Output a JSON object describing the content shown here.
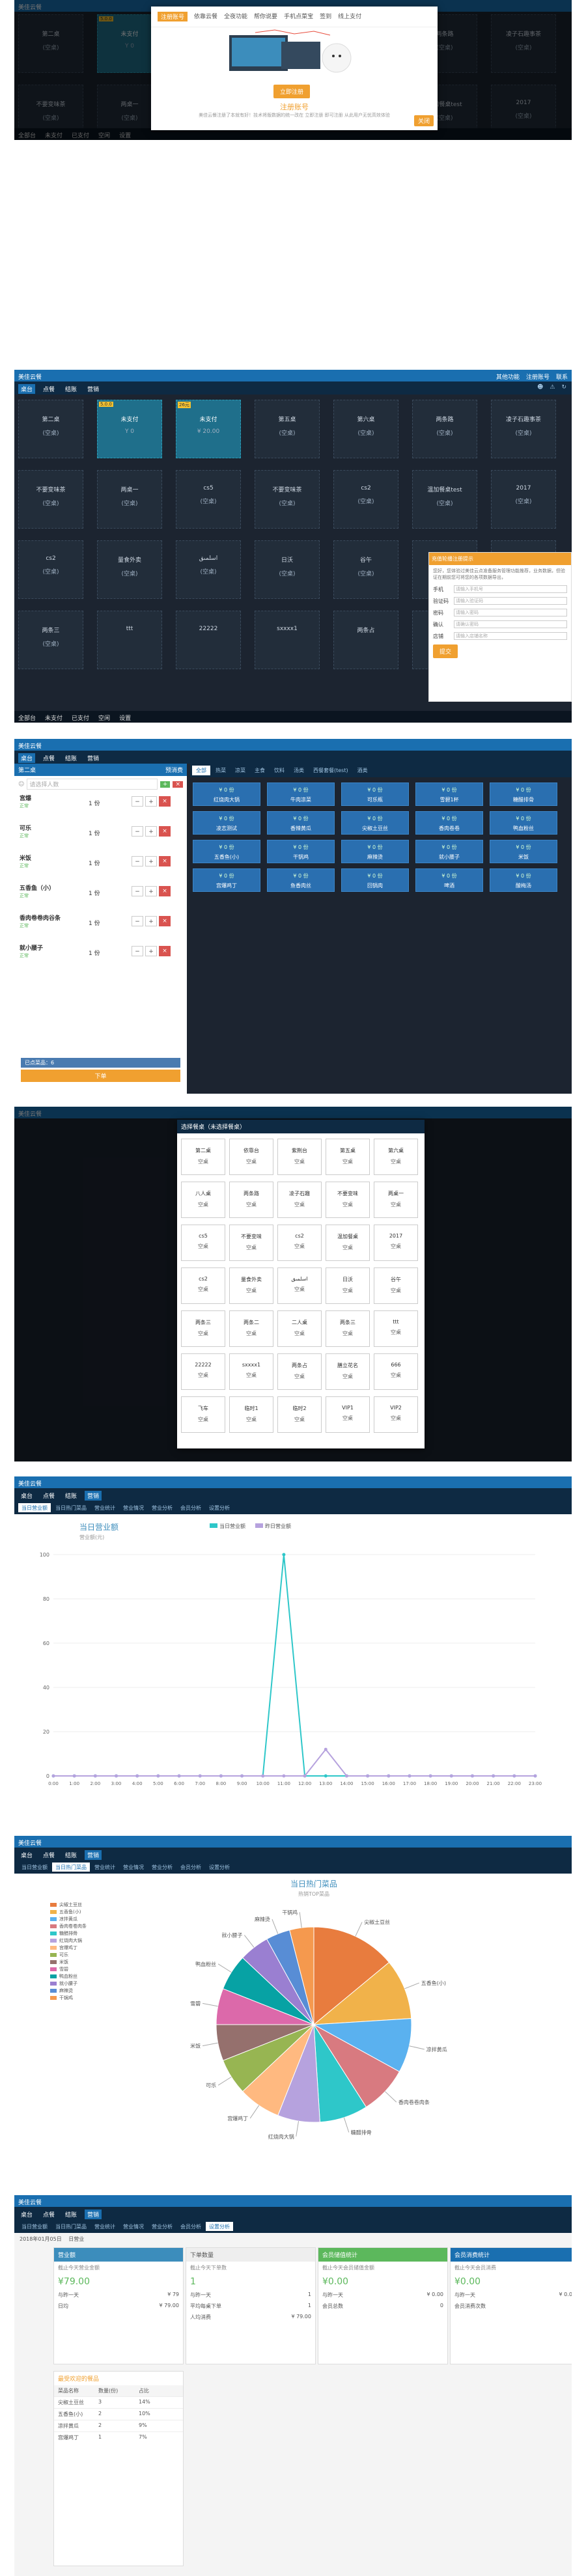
{
  "app": {
    "brand": "美佳云餐",
    "top_right": [
      "其他功能",
      "注册账号",
      "联系"
    ],
    "nav": [
      "桌台",
      "点餐",
      "结账",
      "营销"
    ],
    "bottom": [
      "全部台",
      "未支付",
      "已支付",
      "空闲",
      "设置"
    ]
  },
  "tables": [
    {
      "name": "第二桌",
      "status": "(空桌)"
    },
    {
      "name": "未支付",
      "status": "Y 0",
      "busy": true,
      "flag": "5.0.0"
    },
    {
      "name": "未支付",
      "status": "¥ 20.00",
      "busy": true,
      "flag": "26元"
    },
    {
      "name": "第五桌",
      "status": "(空桌)"
    },
    {
      "name": "第六桌",
      "status": "(空桌)"
    },
    {
      "name": "两条路",
      "status": "(空桌)"
    },
    {
      "name": "凌子石趣事茶",
      "status": "(空桌)"
    },
    {
      "name": "不要变味茶",
      "status": "(空桌)"
    },
    {
      "name": "两桌一",
      "status": "(空桌)"
    },
    {
      "name": "cs5",
      "status": "(空桌)"
    },
    {
      "name": "不要变味茶",
      "status": "(空桌)"
    },
    {
      "name": "cs2",
      "status": "(空桌)"
    },
    {
      "name": "温加餐桌test",
      "status": "(空桌)"
    },
    {
      "name": "2017",
      "status": "(空桌)"
    },
    {
      "name": "cs2",
      "status": "(空桌)"
    },
    {
      "name": "量食外卖",
      "status": "(空桌)"
    },
    {
      "name": "اسلمىق",
      "status": "(空桌)"
    },
    {
      "name": "日沃",
      "status": "(空桌)"
    },
    {
      "name": "谷午",
      "status": "(空桌)"
    },
    {
      "name": "两条三",
      "status": "(空桌)"
    },
    {
      "name": "二人桌",
      "status": "(空桌)"
    },
    {
      "name": "两条三",
      "status": "(空桌)"
    }
  ],
  "bottom_row": [
    "ttt",
    "22222",
    "sxxxx1",
    "两条占",
    "膳立花名",
    "666",
    "飞车"
  ],
  "register_modal": {
    "tabs": [
      "注册账号",
      "依靠云餐",
      "全夜功能",
      "帮你说要",
      "手机点菜宝",
      "签到",
      "线上支付"
    ],
    "button": "立即注册",
    "title": "注册账号",
    "desc": "美佳云餐注册了本就有好！技术将版数据的统一改在 立即注册 即可注册 从此用户无忧高效体验",
    "close": "关闭"
  },
  "side_form": {
    "header": "充值轮播注册提示",
    "tip": "您好，您体验过美佳云点准备服务管理功能推荐，业务数据，但验证在期前您可将您的各项数据导出，",
    "fields": [
      {
        "label": "手机",
        "placeholder": "请输入手机号"
      },
      {
        "label": "验证码",
        "placeholder": "请输入验证码"
      },
      {
        "label": "密码",
        "placeholder": "请输入密码"
      },
      {
        "label": "确认",
        "placeholder": "请确认密码"
      },
      {
        "label": "店铺",
        "placeholder": "请输入店铺名称"
      }
    ],
    "submit": "提交"
  },
  "order": {
    "header": "第二桌",
    "tab": "预消费",
    "search_placeholder": "请选择人数",
    "items": [
      {
        "name": "宫爆",
        "tag": "正常",
        "qty": "1",
        "unit": "份"
      },
      {
        "name": "可乐",
        "tag": "正常",
        "qty": "1",
        "unit": "份"
      },
      {
        "name": "米饭",
        "tag": "正常",
        "qty": "1",
        "unit": "份"
      },
      {
        "name": "五香鱼（小）",
        "tag": "正常",
        "qty": "1",
        "unit": "份"
      },
      {
        "name": "香肉卷卷肉谷条",
        "tag": "正常",
        "qty": "1",
        "unit": "份"
      },
      {
        "name": "就小腰子",
        "tag": "正常",
        "qty": "1",
        "unit": "份"
      }
    ],
    "summary": "已点菜品：6",
    "submit": "下单"
  },
  "menu": {
    "categories": [
      "全部",
      "热菜",
      "凉菜",
      "主食",
      "饮料",
      "汤类",
      "西餐套餐(test)",
      "酒类"
    ],
    "dishes": [
      {
        "price": "¥ 0 份",
        "name": "红烧肉大锅"
      },
      {
        "price": "¥ 0 份",
        "name": "牛肉凉菜"
      },
      {
        "price": "¥ 0 份",
        "name": "可乐瓶"
      },
      {
        "price": "¥ 0 份",
        "name": "雪碧1杯"
      },
      {
        "price": "¥ 0 份",
        "name": "糖醋排骨"
      },
      {
        "price": "¥ 0 份",
        "name": "凌志测试"
      },
      {
        "price": "¥ 0 份",
        "name": "香辣黄瓜"
      },
      {
        "price": "¥ 0 份",
        "name": "尖椒土豆丝"
      },
      {
        "price": "¥ 0 份",
        "name": "香肉卷卷"
      },
      {
        "price": "¥ 0 份",
        "name": "鸭血粉丝"
      },
      {
        "price": "¥ 0 份",
        "name": "五香鱼(小)"
      },
      {
        "price": "¥ 0 份",
        "name": "干锅鸡"
      },
      {
        "price": "¥ 0 份",
        "name": "麻辣烫"
      },
      {
        "price": "¥ 0 份",
        "name": "就小腰子"
      },
      {
        "price": "¥ 0 份",
        "name": "米饭"
      },
      {
        "price": "¥ 0 份",
        "name": "宫爆鸡丁"
      },
      {
        "price": "¥ 0 份",
        "name": "鱼香肉丝"
      },
      {
        "price": "¥ 0 份",
        "name": "回锅肉"
      },
      {
        "price": "¥ 0 份",
        "name": "啤酒"
      },
      {
        "price": "¥ 0 份",
        "name": "酸梅汤"
      }
    ]
  },
  "select_table": {
    "title": "选择餐桌（未选择餐桌）",
    "rows": [
      [
        "第二桌",
        "依靠台",
        "紫荆台",
        "第五桌",
        "第六桌"
      ],
      [
        "八人桌",
        "两条路",
        "凌子石趣",
        "不要变味",
        "两桌一"
      ],
      [
        "cs5",
        "不要变味",
        "cs2",
        "温加餐桌",
        "2017"
      ],
      [
        "cs2",
        "量食外卖",
        "اسلمىق",
        "日沃",
        "谷午"
      ],
      [
        "两条三",
        "两条二",
        "二人桌",
        "两条三",
        "ttt"
      ],
      [
        "22222",
        "sxxxx1",
        "两条占",
        "膳立花名",
        "666"
      ],
      [
        "飞车",
        "临时1",
        "临时2",
        "VIP1",
        "VIP2"
      ]
    ],
    "status": "空桌"
  },
  "report_tabs": [
    "当日营业额",
    "当日热门菜品",
    "营业统计",
    "营业情况",
    "营业分析",
    "会员分析",
    "设置分析"
  ],
  "revenue_chart": {
    "title": "当日营业额",
    "legend": [
      "当日营业额",
      "昨日营业额"
    ]
  },
  "chart_data": [
    {
      "type": "line",
      "title": "当日营业额",
      "ylabel": "营业额(元)",
      "ylim": [
        0,
        100
      ],
      "y_ticks": [
        0,
        20,
        40,
        60,
        80,
        100
      ],
      "x": [
        "0:00",
        "1:00",
        "2:00",
        "3:00",
        "4:00",
        "5:00",
        "6:00",
        "7:00",
        "8:00",
        "9:00",
        "10:00",
        "11:00",
        "12:00",
        "13:00",
        "14:00",
        "15:00",
        "16:00",
        "17:00",
        "18:00",
        "19:00",
        "20:00",
        "21:00",
        "22:00",
        "23:00"
      ],
      "series": [
        {
          "name": "当日营业额",
          "values": [
            0,
            0,
            0,
            0,
            0,
            0,
            0,
            0,
            0,
            0,
            0,
            100,
            0,
            0,
            0,
            0,
            0,
            0,
            0,
            0,
            0,
            0,
            0,
            0
          ]
        },
        {
          "name": "昨日营业额",
          "values": [
            0,
            0,
            0,
            0,
            0,
            0,
            0,
            0,
            0,
            0,
            0,
            0,
            0,
            12,
            0,
            0,
            0,
            0,
            0,
            0,
            0,
            0,
            0,
            0
          ]
        }
      ]
    },
    {
      "type": "pie",
      "title": "当日热门菜品",
      "subtitle": "热销TOP菜品",
      "labels": [
        "尖椒土豆丝",
        "五香鱼(小)",
        "凉拌黄瓜",
        "香肉卷卷肉条",
        "糖醋排骨",
        "红烧肉大锅",
        "宫爆鸡丁",
        "可乐",
        "米饭",
        "雪碧",
        "鸭血粉丝",
        "就小腰子",
        "麻辣烫",
        "干锅鸡"
      ],
      "values": [
        14,
        10,
        9,
        8,
        8,
        7,
        7,
        6,
        6,
        6,
        6,
        5,
        4,
        4
      ]
    }
  ],
  "colors": {
    "pie": [
      "#e87c3e",
      "#f1b24a",
      "#5ab1ef",
      "#d87a80",
      "#2ec7c9",
      "#b6a2de",
      "#ffb980",
      "#97b552",
      "#95706d",
      "#dc69aa",
      "#07a2a4",
      "#9a7fd1",
      "#588dd5",
      "#f5994e"
    ]
  },
  "stats": {
    "date_label": "2018年01月05日",
    "period": "日营业",
    "cards": [
      {
        "title": "营业额",
        "sub": "截止今天营业金额",
        "big": "¥79.00",
        "rows": [
          [
            "与昨一天",
            "¥ 79"
          ],
          [
            "日均",
            "¥ 79.00"
          ]
        ]
      },
      {
        "title": "下单数量",
        "sub": "截止今天下单数",
        "big": "1",
        "rows": [
          [
            "与昨一天",
            "1"
          ],
          [
            "平均每桌下单",
            "1"
          ],
          [
            "人均消费",
            "¥ 79.00"
          ]
        ]
      },
      {
        "title": "会员储值统计",
        "sub": "截止今天会员储值金额",
        "big": "¥0.00",
        "rows": [
          [
            "与昨一天",
            "¥ 0.00"
          ],
          [
            "会员总数",
            "0"
          ]
        ]
      },
      {
        "title": "会员消费统计",
        "sub": "截止今天会员消费",
        "big": "¥0.00",
        "rows": [
          [
            "与昨一天",
            "¥ 0.00"
          ],
          [
            "会员消费次数",
            "0"
          ]
        ]
      }
    ],
    "hot_title": "最受欢迎的餐品",
    "hot_header": [
      "菜品名称",
      "数量(份)",
      "占比"
    ],
    "hot_rows": [
      [
        "尖椒土豆丝",
        "3",
        "14%"
      ],
      [
        "五香鱼(小)",
        "2",
        "10%"
      ],
      [
        "凉拌黄瓜",
        "2",
        "9%"
      ],
      [
        "宫爆鸡丁",
        "1",
        "7%"
      ]
    ]
  }
}
